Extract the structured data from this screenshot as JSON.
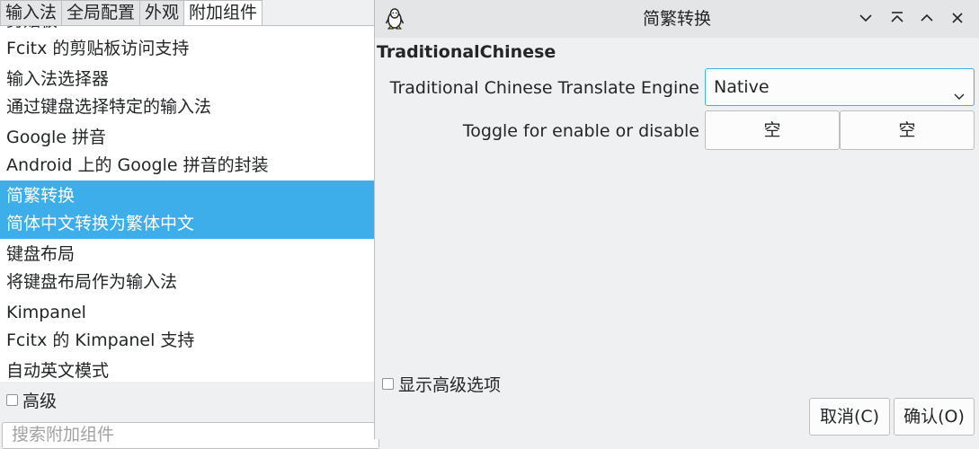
{
  "tabs": [
    "输入法",
    "全局配置",
    "外观",
    "附加组件"
  ],
  "addons": [
    {
      "name": "剪贴板",
      "desc": "Fcitx 的剪贴板访问支持"
    },
    {
      "name": "输入法选择器",
      "desc": "通过键盘选择特定的输入法"
    },
    {
      "name": "Google 拼音",
      "desc": "Android 上的 Google 拼音的封装"
    },
    {
      "name": "简繁转换",
      "desc": "简体中文转换为繁体中文",
      "selected": true
    },
    {
      "name": "键盘布局",
      "desc": "将键盘布局作为输入法"
    },
    {
      "name": "Kimpanel",
      "desc": "Fcitx 的 Kimpanel 支持"
    },
    {
      "name": "自动英文模式",
      "desc": ""
    }
  ],
  "advanced_label": "高级",
  "search_placeholder": "搜索附加组件",
  "dialog": {
    "title": "简繁转换",
    "app_icon": "tux-penguin-icon",
    "section_title": "TraditionalChinese",
    "engine_label": "Traditional Chinese Translate Engine",
    "engine_value": "Native",
    "toggle_label": "Toggle for enable or disable",
    "hotkey1": "空",
    "hotkey2": "空",
    "show_advanced": "显示高级选项",
    "cancel": "取消(C)",
    "ok": "确认(O)"
  },
  "colors": {
    "selection": "#3daee9",
    "window_bg": "#eff0f1",
    "focus_border": "#3daee9"
  }
}
